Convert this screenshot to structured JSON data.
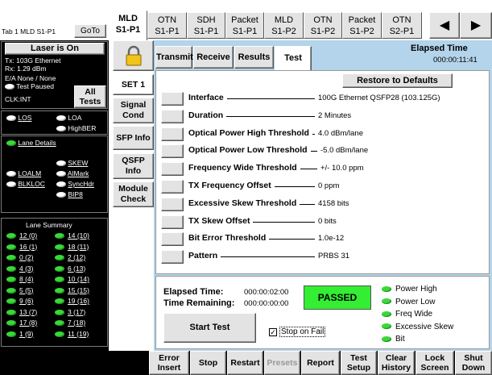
{
  "header": {
    "tab_label": "Tab 1 MLD S1-P1",
    "goto": "GoTo"
  },
  "laser": {
    "button": "Laser is On",
    "tx": "Tx: 103G Ethernet",
    "rx": "Rx: 1.29 dBm",
    "ea": "E/A  None / None",
    "test_paused": "Test Paused",
    "clk": "CLK:INT",
    "all_tests": "All Tests"
  },
  "alarms": {
    "los": "LOS",
    "loa": "LOA",
    "highber": "HighBER"
  },
  "lane_details": {
    "title": "Lane Details",
    "skew": "SKEW",
    "loalm": "LOALM",
    "almark": "AlMark",
    "blkloc": "BLKLOC",
    "synchdr": "SyncHdr",
    "bip8": "BIP8"
  },
  "lane_summary": {
    "title": "Lane Summary",
    "left": [
      "12 (0)",
      "16 (1)",
      "0 (2)",
      "4 (3)",
      "8 (4)",
      "5 (5)",
      "9 (6)",
      "13 (7)",
      "17 (8)",
      "1 (9)"
    ],
    "right": [
      "14 (10)",
      "18 (11)",
      "2 (12)",
      "6 (13)",
      "10 (14)",
      "15 (15)",
      "19 (16)",
      "3 (17)",
      "7 (18)",
      "11 (19)"
    ]
  },
  "tabs": [
    {
      "l1": "MLD",
      "l2": "S1-P1"
    },
    {
      "l1": "OTN",
      "l2": "S1-P1"
    },
    {
      "l1": "SDH",
      "l2": "S1-P1"
    },
    {
      "l1": "Packet",
      "l2": "S1-P1"
    },
    {
      "l1": "MLD",
      "l2": "S1-P2"
    },
    {
      "l1": "OTN",
      "l2": "S1-P2"
    },
    {
      "l1": "Packet",
      "l2": "S1-P2"
    },
    {
      "l1": "OTN",
      "l2": "S2-P1"
    }
  ],
  "arrows": {
    "left": "◀",
    "right": "▶"
  },
  "subtabs": {
    "transmit": "Transmit",
    "receive": "Receive",
    "results": "Results",
    "test": "Test"
  },
  "elapsed_header": {
    "label": "Elapsed Time",
    "value": "000:00:11:41"
  },
  "side": {
    "set1": "SET 1",
    "signal": "Signal Cond",
    "sfp": "SFP Info",
    "qsfp": "QSFP Info",
    "module": "Module Check"
  },
  "restore": "Restore to Defaults",
  "rows": [
    {
      "label": "Interface",
      "value": "100G Ethernet QSFP28 (103.125G)"
    },
    {
      "label": "Duration",
      "value": "2 Minutes"
    },
    {
      "label": "Optical Power High Threshold",
      "value": "4.0 dBm/lane"
    },
    {
      "label": "Optical Power Low Threshold",
      "value": "-5.0 dBm/lane"
    },
    {
      "label": "Frequency Wide Threshold",
      "value": "+/- 10.0 ppm"
    },
    {
      "label": "TX Frequency Offset",
      "value": "0 ppm"
    },
    {
      "label": "Excessive Skew Threshold",
      "value": "4158 bits"
    },
    {
      "label": "TX Skew Offset",
      "value": "0 bits"
    },
    {
      "label": "Bit Error Threshold",
      "value": "1.0e-12"
    },
    {
      "label": "Pattern",
      "value": "PRBS 31"
    }
  ],
  "status": {
    "elapsed_label": "Elapsed Time:",
    "elapsed_value": "000:00:02:00",
    "remaining_label": "Time  Remaining:",
    "remaining_value": "000:00:00:00",
    "result": "PASSED",
    "start": "Start Test",
    "stop_on_fail": "Stop on Fail"
  },
  "indicators": [
    "Power High",
    "Power Low",
    "Freq Wide",
    "Excessive Skew",
    "Bit"
  ],
  "bottom": {
    "error_insert": "Error Insert",
    "stop": "Stop",
    "restart": "Restart",
    "presets": "Presets",
    "report": "Report",
    "test_setup": "Test Setup",
    "clear_history": "Clear History",
    "lock_screen": "Lock Screen",
    "shut_down": "Shut Down"
  },
  "colors": {
    "panel_bg": "#b3d4ea",
    "led_green": "#3ad83a",
    "passed_green": "#33ee33"
  }
}
